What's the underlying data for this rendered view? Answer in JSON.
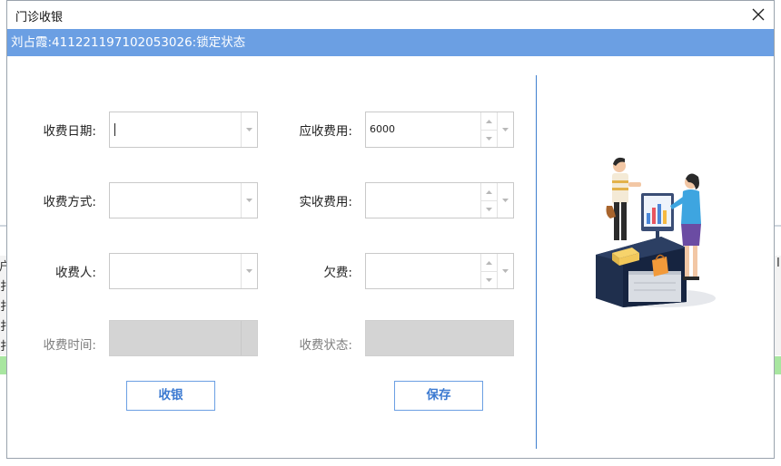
{
  "window": {
    "title": "门诊收银"
  },
  "banner": {
    "text": "刘占霞:411221197102053026:锁定状态"
  },
  "form": {
    "charge_date_label": "收费日期:",
    "charge_method_label": "收费方式:",
    "charger_label": "收费人:",
    "charge_time_label": "收费时间:",
    "receivable_label": "应收费用:",
    "receivable_value": "6000",
    "actual_label": "实收费用:",
    "arrears_label": "欠费:",
    "status_label": "收费状态:"
  },
  "buttons": {
    "cashier": "收银",
    "save": "保存"
  },
  "background": {
    "left_chars": [
      "户",
      "扌",
      "扌",
      "扌",
      "扌"
    ],
    "right_char": "I"
  },
  "colors": {
    "banner": "#6b9fe3",
    "accent": "#3c7ad1",
    "separator": "#3f7fcf",
    "disabled": "#d4d4d4"
  }
}
